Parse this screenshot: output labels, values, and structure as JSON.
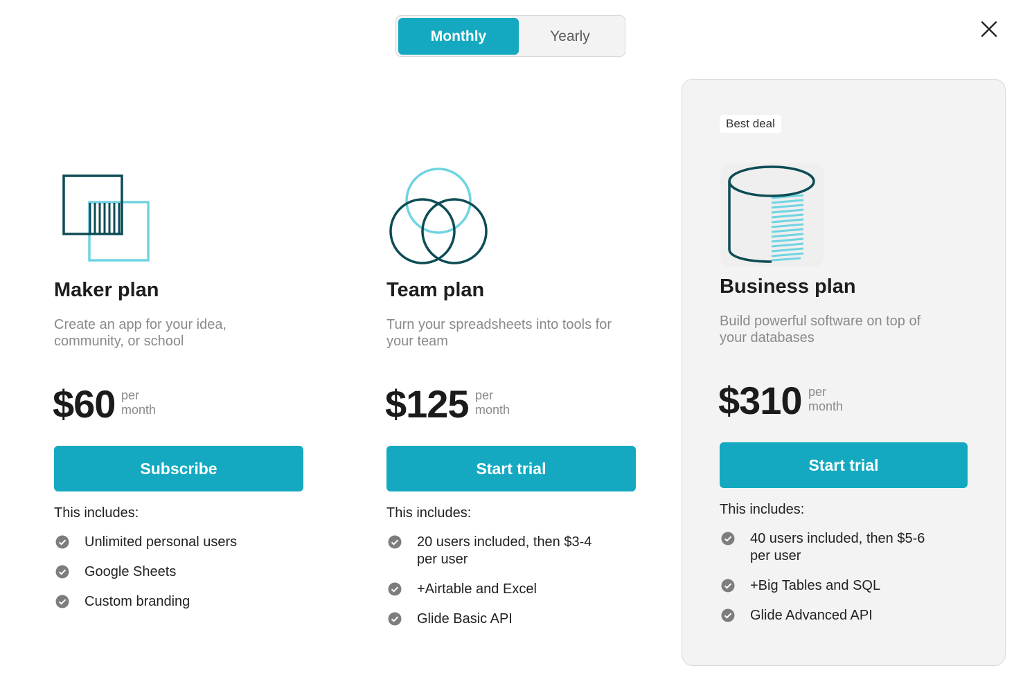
{
  "billing_toggle": {
    "monthly_label": "Monthly",
    "yearly_label": "Yearly",
    "selected": "Monthly"
  },
  "close_icon": "close-icon",
  "colors": {
    "accent": "#14a9c1",
    "dark_teal": "#0d4c55",
    "light_teal": "#6fd4e2"
  },
  "plans": [
    {
      "icon": "overlapping-squares-icon",
      "title": "Maker plan",
      "description": "Create an app for your idea, community, or school",
      "price": "$60",
      "per_1": "per",
      "per_2": "month",
      "cta": "Subscribe",
      "includes_label": "This includes:",
      "features": [
        "Unlimited personal users",
        "Google Sheets",
        "Custom branding"
      ]
    },
    {
      "icon": "overlapping-circles-icon",
      "title": "Team plan",
      "description": "Turn your spreadsheets into tools for your team",
      "price": "$125",
      "per_1": "per",
      "per_2": "month",
      "cta": "Start trial",
      "includes_label": "This includes:",
      "features": [
        "20 users included, then $3-4 per user",
        "+Airtable and Excel",
        "Glide Basic API"
      ]
    },
    {
      "badge": "Best deal",
      "icon": "database-cylinder-icon",
      "title": "Business plan",
      "description": "Build powerful software on top of your databases",
      "price": "$310",
      "per_1": "per",
      "per_2": "month",
      "cta": "Start trial",
      "includes_label": "This includes:",
      "features": [
        "40 users included, then $5-6 per user",
        "+Big Tables and SQL",
        "Glide Advanced API"
      ]
    }
  ]
}
